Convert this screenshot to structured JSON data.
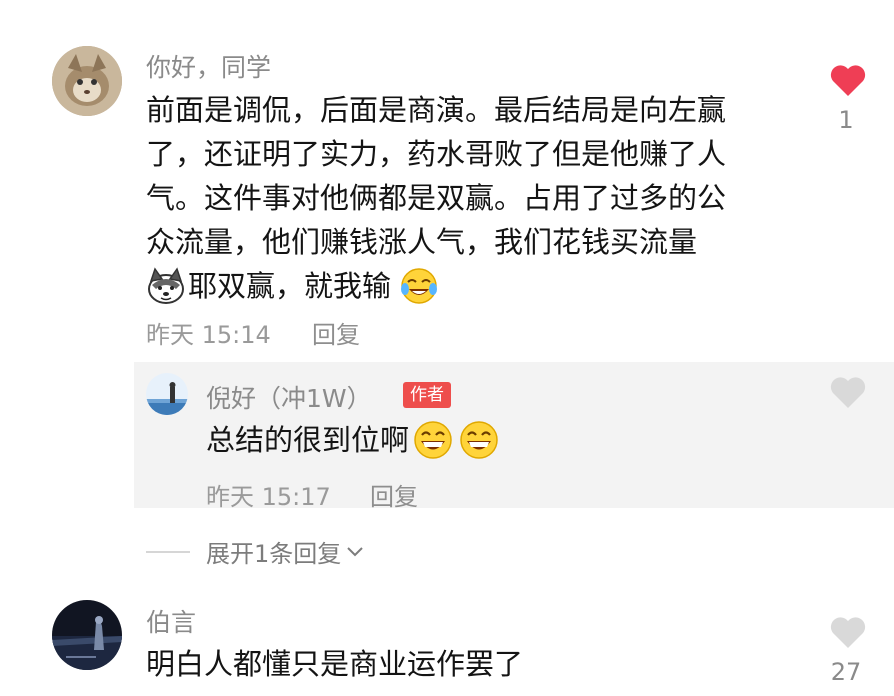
{
  "comments": [
    {
      "username": "你好，同学",
      "lines": [
        "前面是调侃，后面是商演。最后结局是向左赢",
        "了，还证明了实力，药水哥败了但是他赚了人",
        "气。这件事对他俩都是双赢。占用了过多的公",
        "众流量，他们赚钱涨人气，我们花钱买流量"
      ],
      "last_line": "耶双赢，就我输",
      "time": "昨天 15:14",
      "reply_label": "回复",
      "likes": "1",
      "liked": true
    },
    {
      "username": "伯言",
      "text": "明白人都懂只是商业运作罢了",
      "likes": "27",
      "liked": false
    }
  ],
  "reply": {
    "username": "倪好（冲1W）",
    "author_tag": "作者",
    "text": "总结的很到位啊",
    "time": "昨天 15:17",
    "reply_label": "回复"
  },
  "expand": {
    "label": "展开1条回复"
  },
  "icons": {
    "heart": "heart-icon",
    "emoji_husky": "husky-emoji-icon",
    "emoji_laugh_cry": "laugh-cry-emoji-icon",
    "emoji_grin": "grin-emoji-icon",
    "chevron": "chevron-down-icon"
  },
  "colors": {
    "like_active": "#ef3e55",
    "like_inactive": "#d9d9d9",
    "author_tag": "#ee4e4c"
  }
}
